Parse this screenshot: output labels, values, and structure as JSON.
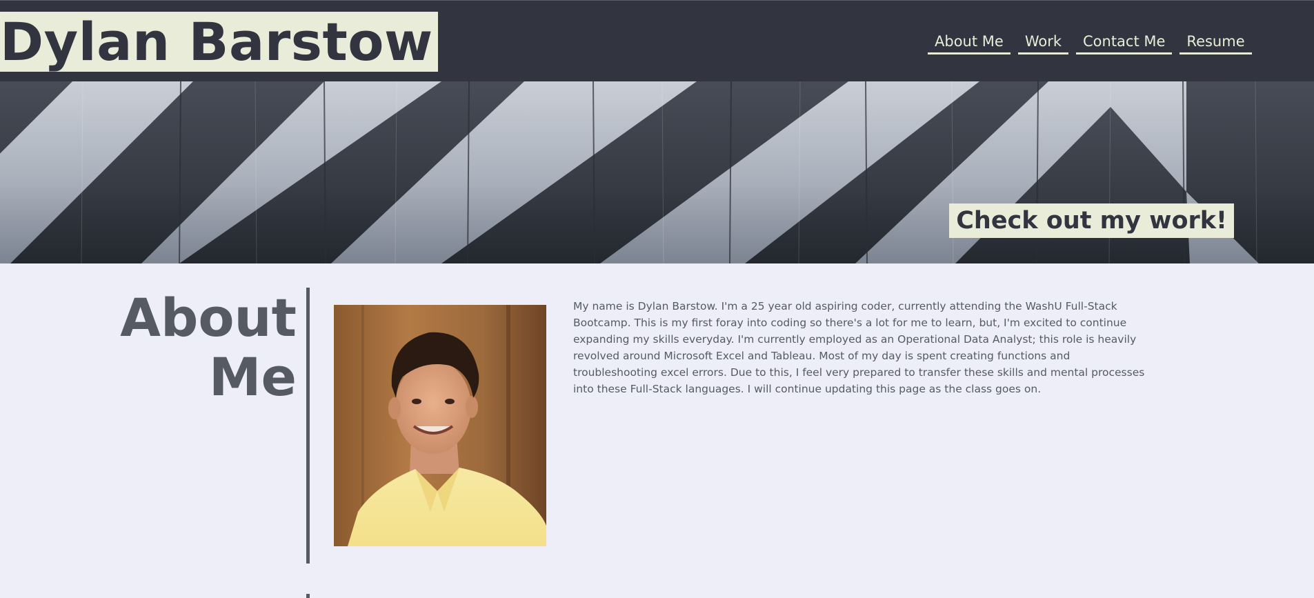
{
  "header": {
    "title": "Dylan Barstow",
    "nav": [
      {
        "label": "About Me"
      },
      {
        "label": "Work"
      },
      {
        "label": "Contact Me"
      },
      {
        "label": "Resume"
      }
    ]
  },
  "hero": {
    "cta": "Check out my work!"
  },
  "about": {
    "heading_line1": "About",
    "heading_line2": "Me",
    "paragraph": "My name is Dylan Barstow. I'm a 25 year old aspiring coder, currently attending the WashU Full-Stack Bootcamp. This is my first foray into coding so there's a lot for me to learn, but, I'm excited to continue expanding my skills everyday. I'm currently employed as an Operational Data Analyst; this role is heavily revolved around Microsoft Excel and Tableau. Most of my day is spent creating functions and troubleshooting excel errors. Due to this, I feel very prepared to transfer these skills and mental processes into these Full-Stack languages. I will continue updating this page as the class goes on."
  },
  "colors": {
    "header_bg": "#32353f",
    "accent_cream": "#e8ecd9",
    "page_bg": "#edeef7",
    "text_gray": "#555a63"
  }
}
